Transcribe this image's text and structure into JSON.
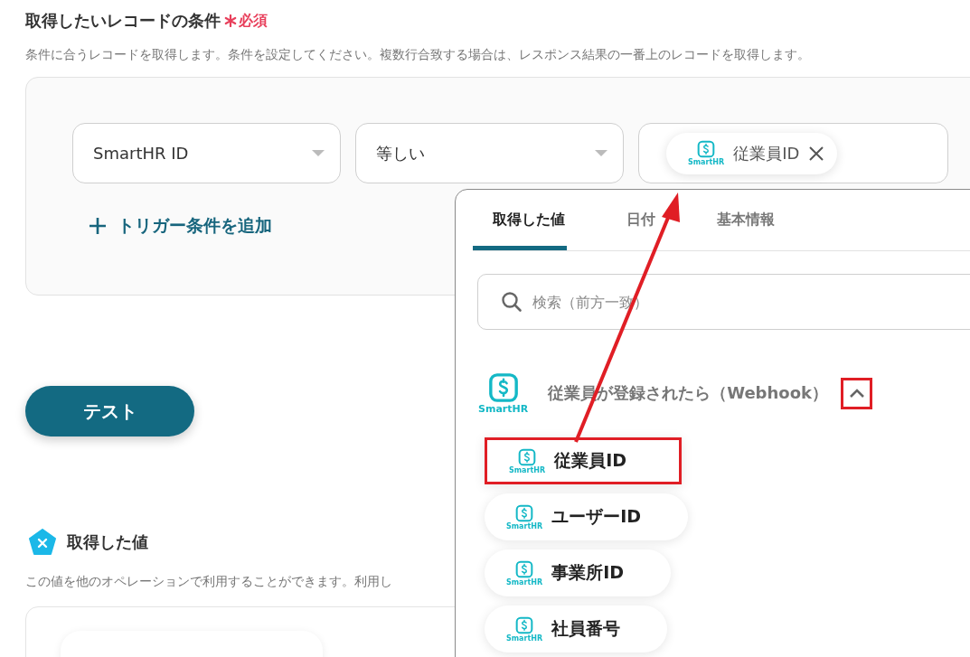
{
  "section": {
    "title": "取得したいレコードの条件",
    "required": "必須",
    "description": "条件に合うレコードを取得します。条件を設定してください。複数行合致する場合は、レスポンス結果の一番上のレコードを取得します。"
  },
  "condition": {
    "field": "SmartHR ID",
    "operator": "等しい",
    "value_chip": {
      "logo_label": "SmartHR",
      "label": "従業員ID"
    },
    "add_button": "トリガー条件を追加"
  },
  "test_button": "テスト",
  "output": {
    "title": "取得した値",
    "description": "この値を他のオペレーションで利用することができます。利用し"
  },
  "picker": {
    "tabs": [
      {
        "label": "取得した値",
        "selected": true
      },
      {
        "label": "日付",
        "selected": false
      },
      {
        "label": "基本情報",
        "selected": false
      }
    ],
    "search": {
      "placeholder": "検索（前方一致）"
    },
    "group": {
      "logo_label": "SmartHR",
      "title": "従業員が登録されたら（Webhook）",
      "expanded": true,
      "highlighted": true,
      "items": [
        {
          "logo_label": "SmartHR",
          "label": "従業員ID",
          "highlighted": true
        },
        {
          "logo_label": "SmartHR",
          "label": "ユーザーID",
          "highlighted": false
        },
        {
          "logo_label": "SmartHR",
          "label": "事業所ID",
          "highlighted": false
        },
        {
          "logo_label": "SmartHR",
          "label": "社員番号",
          "highlighted": false
        }
      ]
    }
  }
}
